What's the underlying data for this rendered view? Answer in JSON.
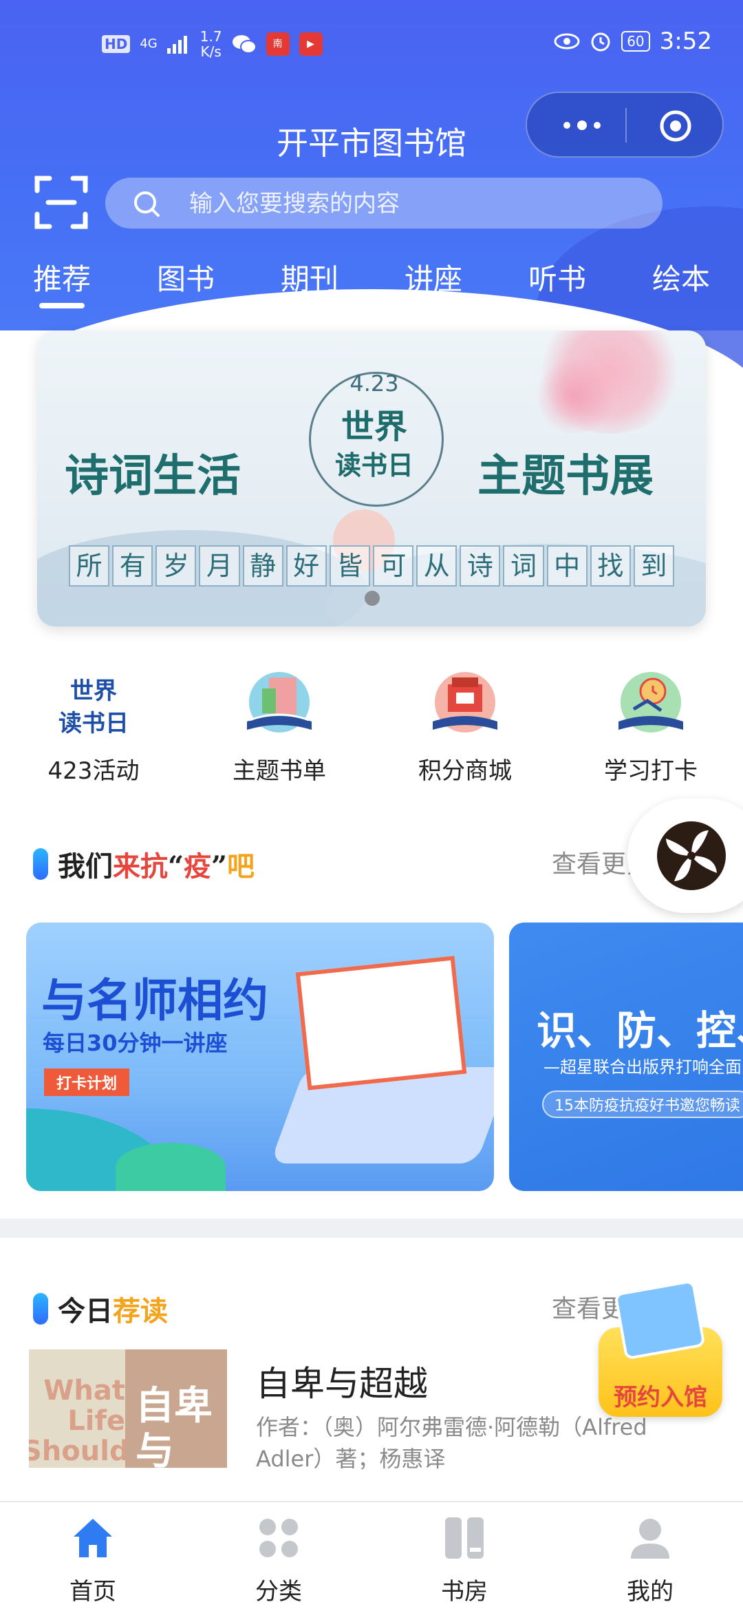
{
  "status_bar": {
    "hd": "HD",
    "network": "4G",
    "speed": "1.7\nK/s",
    "battery": "60",
    "time": "3:52"
  },
  "header": {
    "title": "开平市图书馆",
    "search_placeholder": "输入您要搜索的内容",
    "tabs": [
      "推荐",
      "图书",
      "期刊",
      "讲座",
      "听书",
      "绘本"
    ],
    "active_tab": 0
  },
  "banner": {
    "date": "4.23",
    "world": "世界",
    "reading_day": "读书日",
    "left_text": "诗词生活",
    "right_text": "主题书展",
    "strip_chars": [
      "所",
      "有",
      "岁",
      "月",
      "静",
      "好",
      "皆",
      "可",
      "从",
      "诗",
      "词",
      "中",
      "找",
      "到"
    ]
  },
  "quick_links": [
    {
      "label": "423活动",
      "icon": "world-reading-day-logo"
    },
    {
      "label": "主题书单",
      "icon": "book-list-icon"
    },
    {
      "label": "积分商城",
      "icon": "points-shop-icon"
    },
    {
      "label": "学习打卡",
      "icon": "study-checkin-icon"
    }
  ],
  "section_fight": {
    "title_parts": [
      "我们",
      "来抗",
      "“",
      "疫",
      "”",
      "吧"
    ],
    "see_more": "查看更多"
  },
  "cards": {
    "card1": {
      "title": "与名师相约",
      "subtitle": "每日30分钟一讲座",
      "tag": "打卡计划"
    },
    "card2": {
      "title": "识、防、控、治",
      "subtitle": "—超星联合出版界打响全面战",
      "pill": "15本防疫抗疫好书邀您畅读"
    }
  },
  "section_today": {
    "title_parts": [
      "今日",
      "荐读"
    ],
    "see_more": "查看更多"
  },
  "today_book": {
    "cover_en": "What\nLife\nShould",
    "cover_cn": "自卑\n与",
    "title": "自卑与超越",
    "author": "作者：（奥）阿尔弗雷德·阿德勒（Alfred Adler）著；杨惠译"
  },
  "reserve_badge": {
    "label": "预约入馆"
  },
  "bottom_nav": [
    {
      "label": "首页",
      "icon": "home-icon",
      "active": true
    },
    {
      "label": "分类",
      "icon": "category-icon",
      "active": false
    },
    {
      "label": "书房",
      "icon": "bookshelf-icon",
      "active": false
    },
    {
      "label": "我的",
      "icon": "profile-icon",
      "active": false
    }
  ],
  "colors": {
    "brand_blue": "#4a63f2",
    "active_nav": "#2f7bf2",
    "inactive_nav": "#c4c7cc",
    "accent_red": "#e5473f",
    "accent_orange": "#f3a41c"
  }
}
